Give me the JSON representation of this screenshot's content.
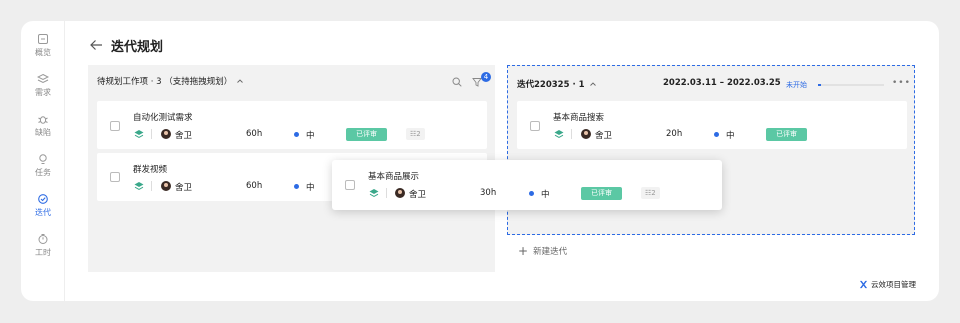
{
  "nav": {
    "items": [
      {
        "label": "概览",
        "icon": "overview-icon"
      },
      {
        "label": "需求",
        "icon": "layers-icon"
      },
      {
        "label": "缺陷",
        "icon": "bug-icon"
      },
      {
        "label": "任务",
        "icon": "bulb-icon"
      },
      {
        "label": "迭代",
        "icon": "iteration-icon",
        "active": true
      },
      {
        "label": "工时",
        "icon": "clock-icon"
      }
    ]
  },
  "header": {
    "title": "迭代规划",
    "back_icon": "back-arrow-icon"
  },
  "backlog": {
    "title": "待规划工作项 · 3 （支持拖拽规划）",
    "filter_count": "4",
    "items": [
      {
        "name": "自动化测试需求",
        "owner": "舍卫",
        "hours": "60h",
        "priority": "中",
        "status": "已评审",
        "subtasks": "2"
      },
      {
        "name": "群发视频",
        "owner": "舍卫",
        "hours": "60h",
        "priority": "中"
      }
    ]
  },
  "sprint": {
    "title": "迭代220325 · 1",
    "dates": "2022.03.11 – 2022.03.25",
    "status": "未开始",
    "progress": 0.05,
    "items": [
      {
        "name": "基本商品搜索",
        "owner": "舍卫",
        "hours": "20h",
        "priority": "中",
        "status": "已评审"
      }
    ],
    "new_label": "新建迭代"
  },
  "dragging": {
    "name": "基本商品展示",
    "owner": "舍卫",
    "hours": "30h",
    "priority": "中",
    "status": "已评审",
    "subtasks": "2"
  },
  "brand": {
    "name": "云效项目管理"
  },
  "colors": {
    "accent": "#2d6be4",
    "status_green": "#5bc8a4",
    "panel_bg": "#f2f2f2"
  }
}
